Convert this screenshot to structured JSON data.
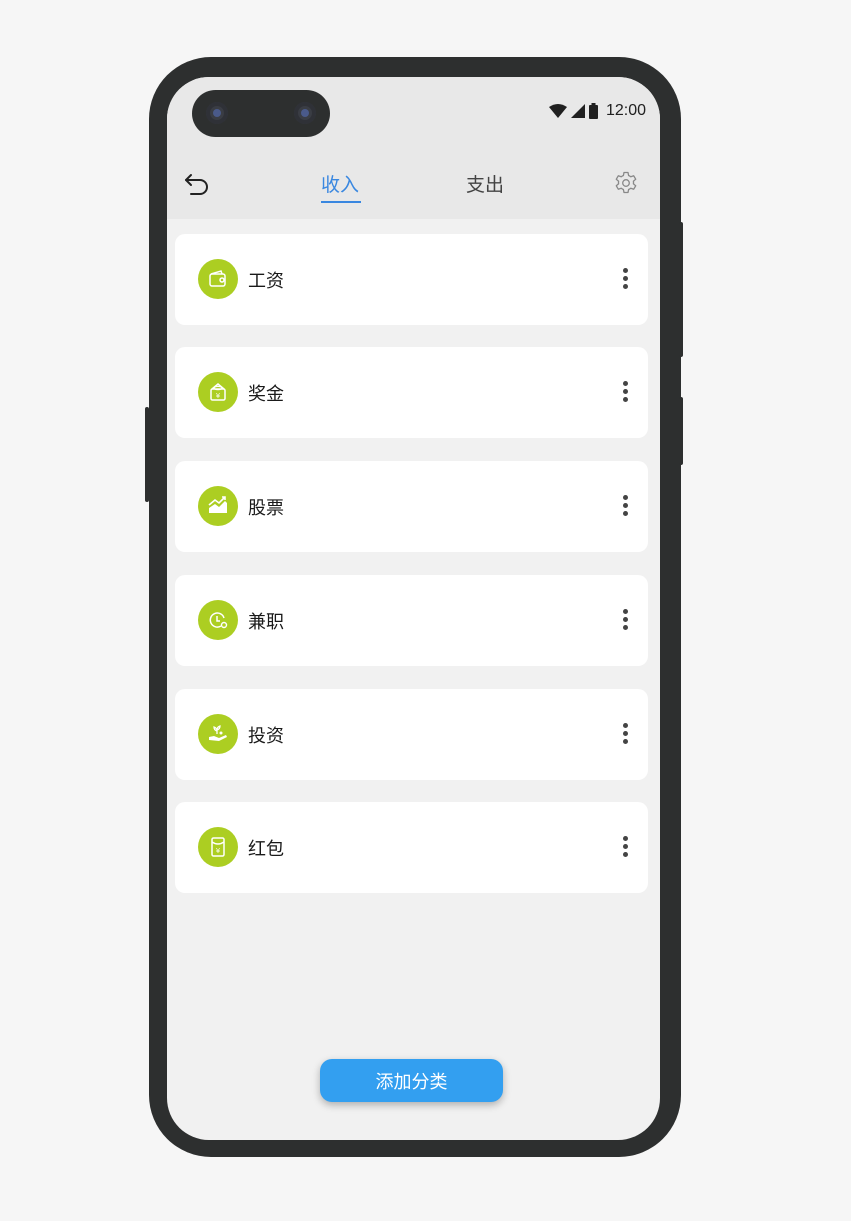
{
  "status_bar": {
    "time": "12:00"
  },
  "header": {
    "tabs": [
      {
        "label": "收入",
        "active": true
      },
      {
        "label": "支出",
        "active": false
      }
    ],
    "accent_color": "#3987e0"
  },
  "categories": [
    {
      "label": "工资",
      "icon": "wallet-icon"
    },
    {
      "label": "奖金",
      "icon": "bonus-bag-icon"
    },
    {
      "label": "股票",
      "icon": "stock-chart-icon"
    },
    {
      "label": "兼职",
      "icon": "part-time-clock-icon"
    },
    {
      "label": "投资",
      "icon": "investment-hand-icon"
    },
    {
      "label": "红包",
      "icon": "red-envelope-icon"
    }
  ],
  "icon_color": "#acce22",
  "add_button": {
    "label": "添加分类",
    "color": "#339ff0"
  }
}
